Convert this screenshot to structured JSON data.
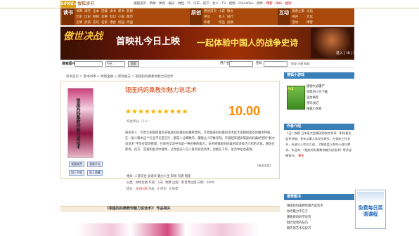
{
  "topbar": {
    "logo": "S#KU.com",
    "logo_sub": "搜狐读书",
    "links": "搜狐首页 - 新闻 - 体育 - 娱乐 - 财经 - IT - 汽车 - 房产 - 女人 - TV - 视频 - ChinaRen - 邮件 -",
    "links_hl": "博客 - BBS - 搜狗"
  },
  "nav": {
    "title1": "读书",
    "grid1": [
      "书库",
      "排行",
      "全本",
      "连载",
      "读书",
      "新书",
      "影视",
      "文史",
      "历史",
      "经管",
      "军事",
      "科幻",
      "小说",
      "都市",
      "言情",
      "武侠",
      "玄幻",
      "名家",
      "港台",
      "校园",
      "外国"
    ],
    "title2": "原创",
    "grid2": [
      "原创首页",
      "小说",
      "散文",
      "评论",
      "新人",
      "排行",
      "作者",
      "作品",
      "投稿"
    ],
    "title3": "互动",
    "grid3": [
      "读者之家",
      "论坛",
      "书评",
      "文化",
      "活动",
      "博客"
    ]
  },
  "banner": {
    "game": "傲世决战",
    "main": "首映礼今日上映",
    "slogan": "一起体验中国人的战争史诗",
    "play": "进入 | 出 | 启"
  },
  "search": {
    "label": "搜索图书",
    "input_value": "",
    "select_value": "书名",
    "button": "搜索",
    "user_label": "用户名",
    "pwd_label": "密码",
    "links": "登录 注册 帮助"
  },
  "breadcrumb": "读书首页 > 图书书库 > 财经金融 > 职场励志 > 银座妈妈桑教你魅力说话术",
  "book": {
    "title": "银座妈妈桑教你魅力说话术",
    "cover_title": "银座妈妈桑教你魅力说话术",
    "stars": "★★★★★★★★★★",
    "score": "10.00",
    "rating_line": "综合评分（1人）",
    "description": "很多客人、毕竟大家都很喜欢去银座妈妈桑妈妈桑经营的。毕竟银座妈妈桑的话术是大家都很喜欢的服务特质，在一般人眼中这个行业不论是言行，都是十分细致的，都能让人印象深刻。毕竟越来越多银座妈妈桑经营的“魅力说话术”不仅在职场管理，在商务交流中也是一种必要的能力。本书将银座妈妈桑的说话技巧介绍给大家，教你在职场、社交、恋爱和生活中使用，让你变成人见人爱的说话高手，也能在工作、生活中左右逢源。",
    "more_link": "[阅读全部]",
    "tags": "相关: 人际交往 说话术 魅力人生 职场 沟通 银座",
    "meta1": "分类：财经金融   作者：（日）牧野   出版：新世界出版   日期：2009",
    "meta2_prefix": "定价：",
    "meta2_value": "￥26.00",
    "meta2_suffix": "   点击：0   评论：0   投票",
    "buttons": [
      "我要推荐",
      "我要评论",
      "加入书架",
      "加入收藏"
    ]
  },
  "related": {
    "title": "《银座妈妈桑教你魅力说话术》：作品相关"
  },
  "right": {
    "games_head": "搜狐小游戏",
    "pvz_label": "PvZ",
    "games": [
      "植物大战僵尸",
      "愤怒的小鸟下载",
      "美女换装",
      "祖玛战记",
      "搜狐小游戏"
    ],
    "intro_head": "作者介绍",
    "intro": "《日》牧野 日本某大型集团的女性领导，职场著名女性领袖，多年从事人际交往研究。在银座工作多年，深谙与人交往之道，了解各类人群的心理与需求。作品有：《银座妈妈桑教你魅力说话术》等多部畅销书。",
    "more": "更多",
    "list_head": "推荐图书",
    "list": [
      "银座妈妈桑教你魅力说话术",
      "你的魅力不在于",
      "跟银座妈妈学说话",
      "魅力说话的技巧",
      "聊天的艺术与技巧"
    ]
  },
  "sidead": {
    "text": "免费每日英语课程"
  }
}
